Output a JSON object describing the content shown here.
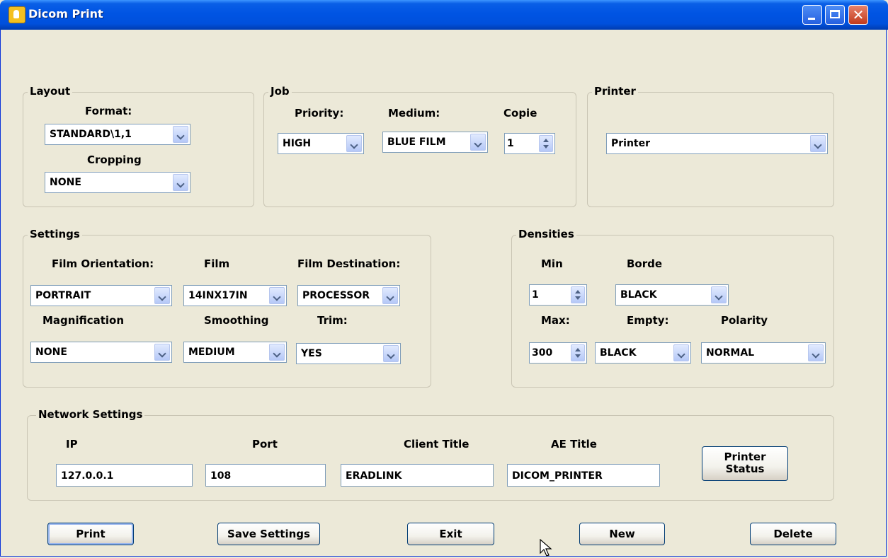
{
  "window": {
    "title": "Dicom Print"
  },
  "layout": {
    "legend": "Layout",
    "format_label": "Format:",
    "format_value": "STANDARD\\1,1",
    "cropping_label": "Cropping",
    "cropping_value": "NONE"
  },
  "job": {
    "legend": "Job",
    "priority_label": "Priority:",
    "priority_value": "HIGH",
    "medium_label": "Medium:",
    "medium_value": "BLUE FILM",
    "copie_label": "Copie",
    "copie_value": "1"
  },
  "printer": {
    "legend": "Printer",
    "value": "Printer"
  },
  "settings": {
    "legend": "Settings",
    "orientation_label": "Film Orientation:",
    "orientation_value": "PORTRAIT",
    "film_label": "Film",
    "film_value": "14INX17IN",
    "destination_label": "Film Destination:",
    "destination_value": "PROCESSOR",
    "magnification_label": "Magnification",
    "magnification_value": "NONE",
    "smoothing_label": "Smoothing",
    "smoothing_value": "MEDIUM",
    "trim_label": "Trim:",
    "trim_value": "YES"
  },
  "densities": {
    "legend": "Densities",
    "min_label": "Min",
    "min_value": "1",
    "borde_label": "Borde",
    "borde_value": "BLACK",
    "max_label": "Max:",
    "max_value": "300",
    "empty_label": "Empty:",
    "empty_value": "BLACK",
    "polarity_label": "Polarity",
    "polarity_value": "NORMAL"
  },
  "network": {
    "legend": "Network Settings",
    "ip_label": "IP",
    "ip_value": "127.0.0.1",
    "port_label": "Port",
    "port_value": "108",
    "client_label": "Client Title",
    "client_value": "ERADLINK",
    "ae_label": "AE Title",
    "ae_value": "DICOM_PRINTER",
    "status_button_line1": "Printer",
    "status_button_line2": "Status"
  },
  "buttons": {
    "print": "Print",
    "save": "Save Settings",
    "exit": "Exit",
    "new": "New",
    "delete": "Delete"
  }
}
